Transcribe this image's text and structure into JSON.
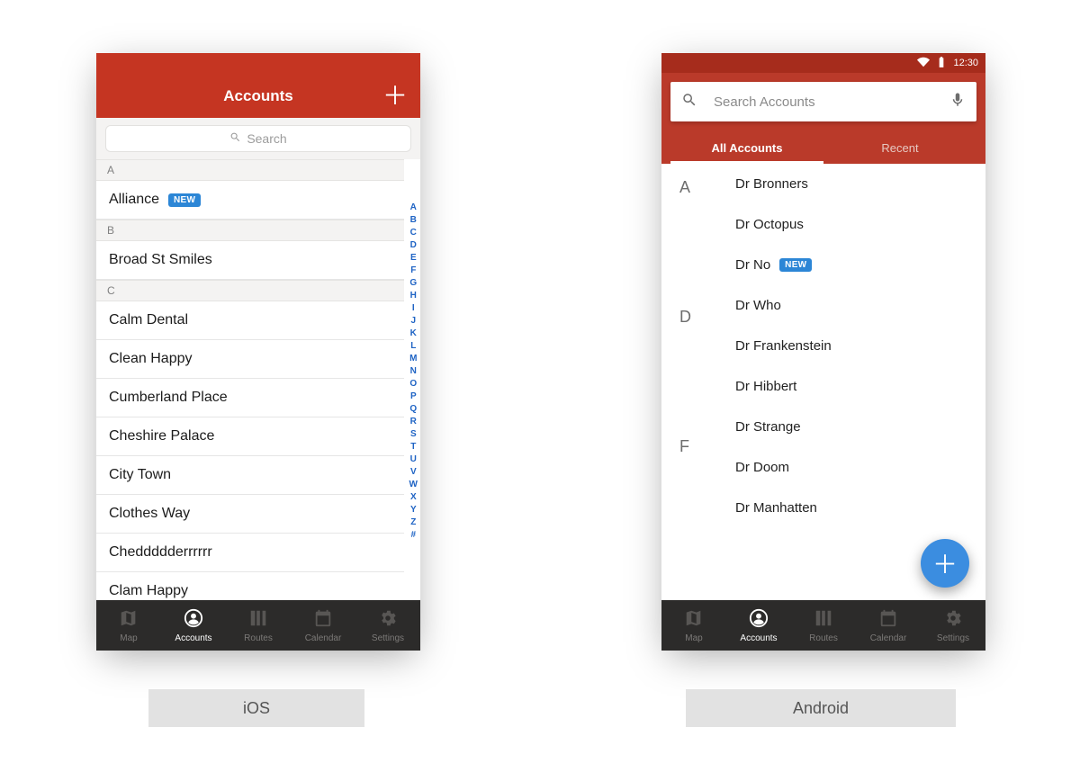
{
  "colors": {
    "ios_brand": "#c53522",
    "android_brand": "#ba3a2a",
    "tabbar": "#2c2b2a",
    "fab": "#3b8de0",
    "badge": "#2c86d6"
  },
  "badges": {
    "new": "NEW"
  },
  "ios": {
    "title": "Accounts",
    "search_placeholder": "Search",
    "sections": {
      "a": "A",
      "b": "B",
      "c": "C"
    },
    "rows": {
      "alliance": "Alliance",
      "broad": "Broad St Smiles",
      "calm": "Calm Dental",
      "clean": "Clean Happy",
      "cumberland": "Cumberland Place",
      "cheshire": "Cheshire Palace",
      "city": "City Town",
      "clothes": "Clothes Way",
      "chedd": "Cheddddderrrrrr",
      "clam": "Clam Happy"
    },
    "index_letters": [
      "A",
      "B",
      "C",
      "D",
      "E",
      "F",
      "G",
      "H",
      "I",
      "J",
      "K",
      "L",
      "M",
      "N",
      "O",
      "P",
      "Q",
      "R",
      "S",
      "T",
      "U",
      "V",
      "W",
      "X",
      "Y",
      "Z",
      "#"
    ]
  },
  "android": {
    "status_time": "12:30",
    "search_placeholder": "Search Accounts",
    "tabs": {
      "all": "All Accounts",
      "recent": "Recent"
    },
    "section_letters": {
      "a": "A",
      "d": "D",
      "f": "F"
    },
    "rows": {
      "bronners": "Dr Bronners",
      "octopus": "Dr Octopus",
      "no": "Dr No",
      "who": "Dr Who",
      "frankenstein": "Dr Frankenstein",
      "hibbert": "Dr Hibbert",
      "strange": "Dr Strange",
      "doom": "Dr Doom",
      "manhatten": "Dr Manhatten"
    }
  },
  "tabs": {
    "map": "Map",
    "accounts": "Accounts",
    "routes": "Routes",
    "calendar": "Calendar",
    "settings": "Settings"
  },
  "platform_labels": {
    "ios": "iOS",
    "android": "Android"
  }
}
